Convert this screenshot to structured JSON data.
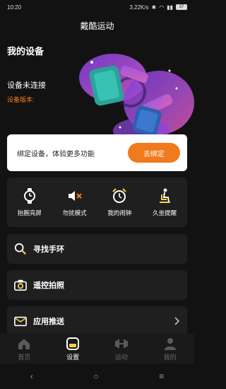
{
  "status_bar": {
    "time": "10:20",
    "network_speed": "3.22K/s",
    "battery": "37"
  },
  "header": {
    "title": "戴酷运动"
  },
  "device": {
    "section_title": "我的设备",
    "status": "设备未连接",
    "version_label": "设备版本:"
  },
  "bind_card": {
    "text": "绑定设备，体验更多功能",
    "button_label": "去绑定"
  },
  "features": [
    {
      "label": "抬腕亮屏",
      "icon": "watch-icon"
    },
    {
      "label": "勿扰模式",
      "icon": "mute-speaker-icon"
    },
    {
      "label": "我的闹钟",
      "icon": "alarm-clock-icon"
    },
    {
      "label": "久坐提醒",
      "icon": "sitting-person-icon"
    }
  ],
  "list_items": [
    {
      "label": "寻找手环",
      "icon": "search-icon"
    },
    {
      "label": "遥控拍照",
      "icon": "camera-icon"
    },
    {
      "label": "应用推送",
      "icon": "envelope-icon"
    }
  ],
  "tabs": [
    {
      "label": "首页",
      "icon": "home-icon",
      "active": false
    },
    {
      "label": "设置",
      "icon": "settings-device-icon",
      "active": true
    },
    {
      "label": "运动",
      "icon": "dumbbell-icon",
      "active": false
    },
    {
      "label": "我的",
      "icon": "person-icon",
      "active": false
    }
  ],
  "nav": {
    "back": "‹",
    "home": "○",
    "menu": "≡"
  },
  "colors": {
    "accent": "#f07a1c",
    "background": "#121212",
    "card": "#1f1f1f",
    "feature_icon": "#ffffff",
    "list_icon": "#f5d142"
  }
}
